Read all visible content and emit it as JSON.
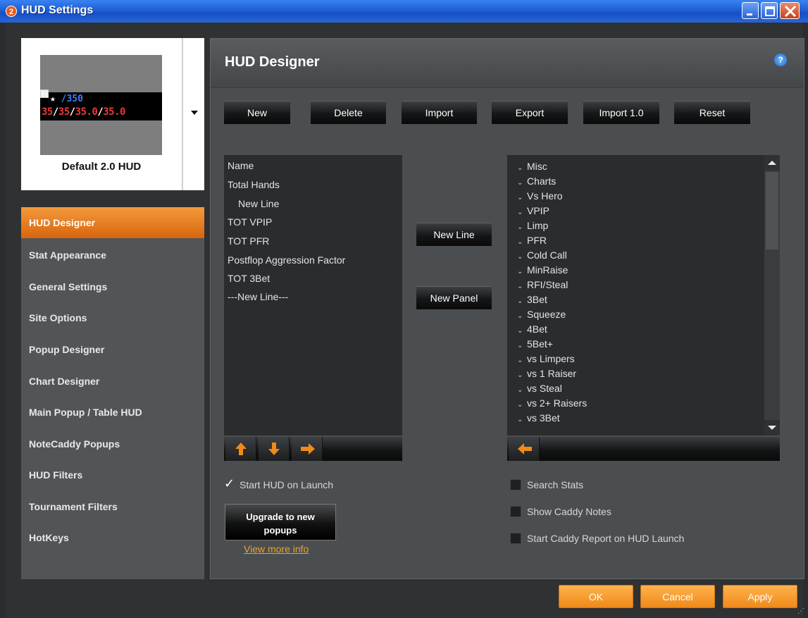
{
  "window": {
    "title": "HUD Settings",
    "app_icon_letter": "2"
  },
  "hud_card": {
    "name": "Default 2.0 HUD",
    "preview_line1": "/350",
    "preview_line1_prefix": "★ ",
    "preview_line2": [
      "35",
      "35",
      "35.0",
      "35.0"
    ]
  },
  "sidebar": {
    "items": [
      {
        "label": "HUD Designer",
        "active": true
      },
      {
        "label": "Stat Appearance"
      },
      {
        "label": "General Settings"
      },
      {
        "label": "Site Options"
      },
      {
        "label": "Popup Designer"
      },
      {
        "label": "Chart Designer"
      },
      {
        "label": "Main Popup / Table HUD"
      },
      {
        "label": "NoteCaddy Popups"
      },
      {
        "label": "HUD Filters"
      },
      {
        "label": "Tournament Filters"
      },
      {
        "label": "HotKeys"
      }
    ]
  },
  "panel": {
    "title": "HUD Designer",
    "help_icon": "?",
    "toolbar": [
      "New",
      "Delete",
      "Import",
      "Export",
      "Import 1.0",
      "Reset"
    ],
    "layout_list": [
      "Name",
      "Total Hands",
      "New Line",
      "TOT VPIP",
      "TOT PFR",
      "Postflop Aggression Factor",
      "TOT 3Bet",
      "---New Line---"
    ],
    "new_line_label": "New Line",
    "new_panel_label": "New Panel",
    "stat_tree": [
      "Misc",
      "Charts",
      "Vs Hero",
      "VPIP",
      "Limp",
      "PFR",
      "Cold Call",
      "MinRaise",
      "RFI/Steal",
      "3Bet",
      "Squeeze",
      "4Bet",
      "5Bet+",
      "vs Limpers",
      "vs 1 Raiser",
      "vs Steal",
      "vs 2+ Raisers",
      "vs 3Bet"
    ],
    "start_hud_label": "Start HUD on Launch",
    "start_hud_checked": true,
    "search_stats_label": "Search Stats",
    "show_caddy_label": "Show Caddy Notes",
    "start_caddy_label": "Start Caddy Report on HUD Launch",
    "upgrade_line1": "Upgrade to new",
    "upgrade_line2": "popups",
    "view_more": "View more info"
  },
  "footer": {
    "ok": "OK",
    "cancel": "Cancel",
    "apply": "Apply"
  },
  "colors": {
    "accent": "#f08a1a",
    "titlebar": "#1d5fd6",
    "panel": "#4b4e50"
  }
}
